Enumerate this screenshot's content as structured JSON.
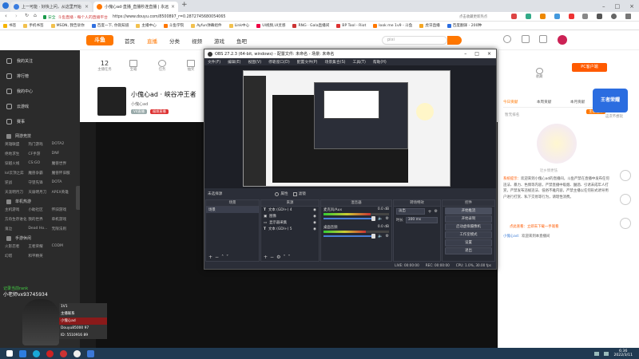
{
  "browser": {
    "tabs": [
      {
        "label": "上一可能 · 好快上问，从这里开始"
      },
      {
        "label": "小傀心ad·直播_直播秒连直播 | 永远"
      }
    ],
    "new_tab": "+",
    "url_prefix": "安全",
    "url_site": "斗鱼直播 - 每个人的直播平台",
    "url": "https://www.douyu.com/8500897_r=0.2872745680054065",
    "bookmarks": [
      "书签",
      "手机书签",
      "MSDN, 我告诉你",
      "百度一下, 你就知道",
      "主播中心",
      "斗鱼学院",
      "Ayfun弹幕组件",
      "Link中心",
      "UI视频,UI灵感",
      "RNG · Gala直播间",
      "BP Tool - Riot",
      "look me 1v9 - 斗鱼",
      "虎牙直播",
      "百度翻译 - 200种"
    ],
    "search_hint": "点击收藏更新热点"
  },
  "douyu": {
    "logo": "斗鱼",
    "nav": [
      "首页",
      "直播",
      "分类",
      "视频",
      "游戏",
      "鱼吧"
    ],
    "search_placeholder": "pixi",
    "search_icon": "search-icon",
    "pc_client": "PC客户端",
    "room_stats": [
      {
        "value": "12",
        "label": "主播任务"
      },
      {
        "value": "",
        "label": "宝箱"
      },
      {
        "value": "",
        "label": "任务"
      },
      {
        "value": "",
        "label": "抽奖"
      },
      {
        "value": "",
        "label": "礼包"
      }
    ],
    "favorite": "收藏",
    "room_title": "小傀心ad · 峡谷冲王者",
    "streamer": "小傀心ad",
    "tags": [
      "V4直播",
      "福袋直播"
    ],
    "sidebar": {
      "items": [
        "我的关注",
        "排行榜",
        "我的中心",
        "云游戏",
        "赛事"
      ],
      "sections": [
        {
          "title": "网游竞技",
          "items": [
            "英雄联盟",
            "热门游戏",
            "DOTA2",
            "绝地求生",
            "CF手游",
            "DNF",
            "穿越火线",
            "CS:GO",
            "魔兽世界",
            "lol云顶之弈",
            "魔兽争霸",
            "魔兽怀旧服",
            "逆战",
            "守望先锋",
            "DOTA",
            "天涯明月刀",
            "天谕明月刀",
            "APEX英雄"
          ]
        },
        {
          "title": "单机热游",
          "items": [
            "主机游戏",
            "小助社区",
            "怀旧游戏",
            "方舟生存进化",
            "我的世界",
            "单机游戏",
            "鬼泣",
            "Dead Ho...",
            "无限法则"
          ]
        },
        {
          "title": "手游休闲",
          "items": [
            "火影忍者",
            "王者荣耀",
            "CODM",
            "幻塔",
            "和平精英"
          ]
        }
      ]
    },
    "right_tabs": [
      "今日贡献",
      "本周贡献",
      "本月贡献",
      "贵宾"
    ],
    "rank_empty": "暂无排名",
    "room_badge": "主播任务",
    "notice_label": "系统提示：",
    "notice": "欢迎来到小傀心ad的直播间，斗鱼严禁在直播中发布任何违法、暴力、色情等内容，严禁直播中吸烟、酗酒、引诱未成年人打赏，严禁发布违规违法、低俗不雅内容，严禁主播以任何形式诱导用户进行打赏、私下交易等行为，请理性消费。",
    "notice2": "点此查看：立即去下载一手观看",
    "chat_line": {
      "user": "小傀心ad:",
      "text": "欢迎来到本直播间"
    },
    "game_badge": "王者荣耀",
    "promo_text": "这次不想玩",
    "watermark_text": "近乡情更怯",
    "overlay_lines": [
      "记录当前rank",
      "小老师vx93745934",
      "1V1",
      "主播联系",
      "小傀心ad",
      "Douyu85000 97",
      "ID: 5510916 89"
    ]
  },
  "obs": {
    "title": "OBS 27.2.3 (64-bit, windows) - 配置文件: 未命名 - 场景: 未命名",
    "menu": [
      "文件(F)",
      "编辑(E)",
      "视图(V)",
      "停靠窗口(D)",
      "配置文件(P)",
      "场景集合(S)",
      "工具(T)",
      "帮助(H)"
    ],
    "source_status": "未选择源",
    "props_btn": "属性",
    "filter_btn": "滤镜",
    "docks": {
      "scenes": {
        "title": "场景",
        "items": [
          "场景"
        ]
      },
      "sources": {
        "title": "来源",
        "items": [
          "文本 (GDI+) 4",
          "图像",
          "显示器采集",
          "文本 (GDI+) 5"
        ]
      },
      "mixer": {
        "title": "混音器",
        "items": [
          {
            "name": "麦克风/Aux",
            "db": "0.0 dB",
            "level": 0.72
          },
          {
            "name": "桌面音频",
            "db": "0.0 dB",
            "level": 0.65
          }
        ]
      },
      "transitions": {
        "title": "转场特效",
        "mode": "淡出",
        "duration_label": "时长",
        "duration": "300 ms"
      },
      "controls": {
        "title": "控件",
        "buttons": [
          "开始推流",
          "开始录制",
          "启动虚拟摄像机",
          "工作室模式",
          "设置",
          "退出"
        ]
      }
    },
    "status": [
      "LIVE: 00:00:00",
      "REC: 00:00:00",
      "CPU: 1.0%, 30.00 fps"
    ]
  },
  "taskbar": {
    "time": "6:36",
    "date": "2022/3/11",
    "apps": [
      "start-icon",
      "file-explorer-icon",
      "edge-icon",
      "chrome-icon",
      "app-icon",
      "obs-icon",
      "app2-icon"
    ],
    "colors": [
      "#ffffff",
      "#2d7de0",
      "#19a8d8",
      "#cc2222",
      "#cc3333",
      "#eeeeee",
      "#3b78d8"
    ]
  },
  "colors": {
    "douyu_orange": "#ff7700",
    "obs_bg": "#2b2e38",
    "sidebar_bg": "#2b2b2b",
    "taskbar_bg": "#203a52"
  }
}
